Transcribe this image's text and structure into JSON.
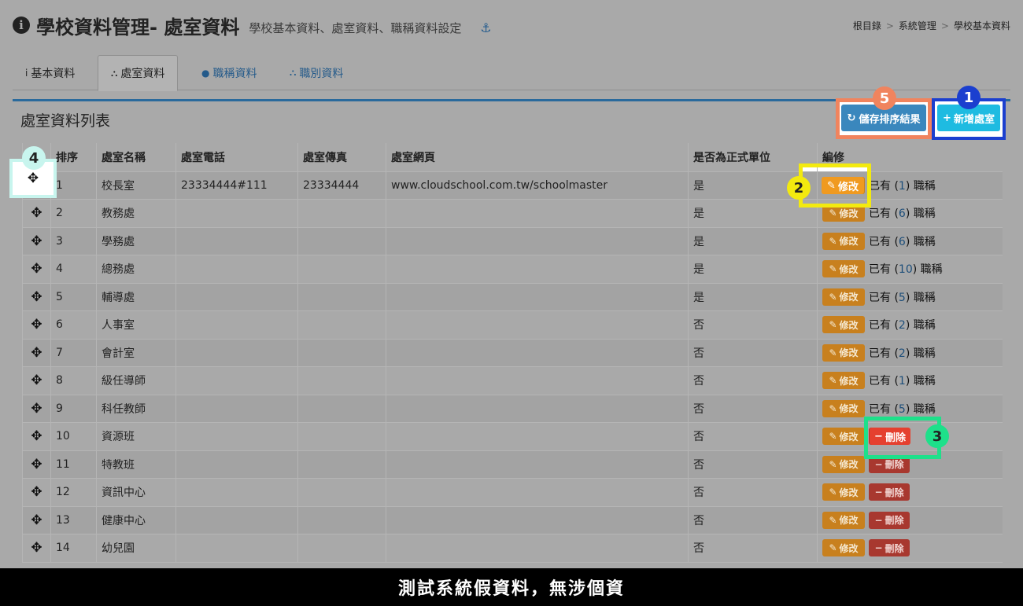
{
  "header": {
    "title": "學校資料管理- 處室資料",
    "subtitle": "學校基本資料、處室資料、職稱資料設定",
    "info_icon": "i",
    "anchor_icon": "⚓"
  },
  "breadcrumb": [
    "根目錄",
    "系統管理",
    "學校基本資料"
  ],
  "breadcrumb_sep": ">",
  "tabs": [
    {
      "label": "基本資料",
      "icon": "i"
    },
    {
      "label": "處室資料",
      "icon": "⛬"
    },
    {
      "label": "職稱資料",
      "icon": "●"
    },
    {
      "label": "職別資料",
      "icon": "⛬"
    }
  ],
  "panel": {
    "title": "處室資料列表",
    "save_label": "儲存排序結果",
    "add_label": "新增處室",
    "save_icon": "↻",
    "add_icon": "+"
  },
  "table": {
    "headers": [
      "",
      "排序",
      "處室名稱",
      "處室電話",
      "處室傳真",
      "處室網頁",
      "是否為正式單位",
      "編修"
    ],
    "rows": [
      {
        "order": "1",
        "name": "校長室",
        "phone": "23334444#111",
        "fax": "23334444",
        "web": "www.cloudschool.com.tw/schoolmaster",
        "official": "是",
        "count": "1",
        "del": false
      },
      {
        "order": "2",
        "name": "教務處",
        "phone": "",
        "fax": "",
        "web": "",
        "official": "是",
        "count": "6",
        "del": false
      },
      {
        "order": "3",
        "name": "學務處",
        "phone": "",
        "fax": "",
        "web": "",
        "official": "是",
        "count": "6",
        "del": false
      },
      {
        "order": "4",
        "name": "總務處",
        "phone": "",
        "fax": "",
        "web": "",
        "official": "是",
        "count": "10",
        "del": false
      },
      {
        "order": "5",
        "name": "輔導處",
        "phone": "",
        "fax": "",
        "web": "",
        "official": "是",
        "count": "5",
        "del": false
      },
      {
        "order": "6",
        "name": "人事室",
        "phone": "",
        "fax": "",
        "web": "",
        "official": "否",
        "count": "2",
        "del": false
      },
      {
        "order": "7",
        "name": "會計室",
        "phone": "",
        "fax": "",
        "web": "",
        "official": "否",
        "count": "2",
        "del": false
      },
      {
        "order": "8",
        "name": "級任導師",
        "phone": "",
        "fax": "",
        "web": "",
        "official": "否",
        "count": "1",
        "del": false
      },
      {
        "order": "9",
        "name": "科任教師",
        "phone": "",
        "fax": "",
        "web": "",
        "official": "否",
        "count": "5",
        "del": false
      },
      {
        "order": "10",
        "name": "資源班",
        "phone": "",
        "fax": "",
        "web": "",
        "official": "否",
        "count": "",
        "del": true
      },
      {
        "order": "11",
        "name": "特教班",
        "phone": "",
        "fax": "",
        "web": "",
        "official": "否",
        "count": "",
        "del": true
      },
      {
        "order": "12",
        "name": "資訊中心",
        "phone": "",
        "fax": "",
        "web": "",
        "official": "否",
        "count": "",
        "del": true
      },
      {
        "order": "13",
        "name": "健康中心",
        "phone": "",
        "fax": "",
        "web": "",
        "official": "否",
        "count": "",
        "del": true
      },
      {
        "order": "14",
        "name": "幼兒園",
        "phone": "",
        "fax": "",
        "web": "",
        "official": "否",
        "count": "",
        "del": true
      }
    ],
    "edit_label": "修改",
    "delete_label": "刪除",
    "edit_icon": "✎",
    "delete_icon": "−",
    "drag_icon": "✥",
    "count_prefix": "已有 (",
    "count_suffix": ") 職稱"
  },
  "badges": {
    "b1": "1",
    "b2": "2",
    "b3": "3",
    "b4": "4",
    "b5": "5"
  },
  "banner": "測試系統假資料，無涉個資",
  "colors": {
    "save": "#3a87bd",
    "add": "#1ebbe1",
    "edit": "#f09a20",
    "delete": "#e5402f",
    "accent": "#2a6a9c"
  }
}
